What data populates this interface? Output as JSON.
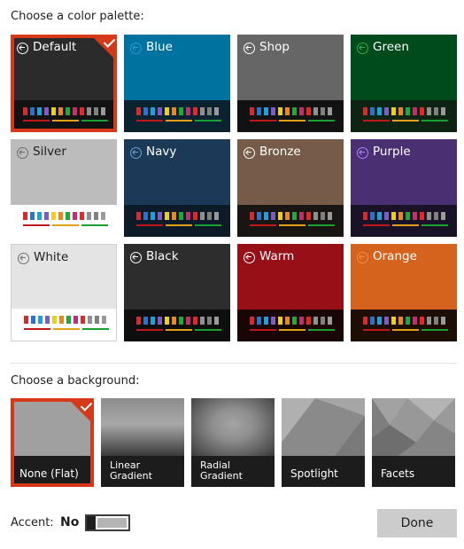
{
  "palette_section": {
    "title": "Choose a color palette:",
    "selected": "Default",
    "palettes": [
      {
        "name": "Default",
        "bg": "#2b2b2b",
        "bar": "#121212",
        "light": false
      },
      {
        "name": "Blue",
        "bg": "#0072a0",
        "bar": "#0b2330",
        "light": false
      },
      {
        "name": "Shop",
        "bg": "#666666",
        "bar": "#121212",
        "light": false
      },
      {
        "name": "Green",
        "bg": "#004b1c",
        "bar": "#0d2412",
        "light": false
      },
      {
        "name": "Silver",
        "bg": "#bcbcbc",
        "bar": "#ffffff",
        "light": true
      },
      {
        "name": "Navy",
        "bg": "#1c3a57",
        "bar": "#0d1a28",
        "light": false
      },
      {
        "name": "Bronze",
        "bg": "#765c48",
        "bar": "#191512",
        "light": false
      },
      {
        "name": "Purple",
        "bg": "#4b2f73",
        "bar": "#1a1226",
        "light": false
      },
      {
        "name": "White",
        "bg": "#e4e4e4",
        "bar": "#ffffff",
        "light": true
      },
      {
        "name": "Black",
        "bg": "#2d2d2d",
        "bar": "#0e0e0e",
        "light": false
      },
      {
        "name": "Warm",
        "bg": "#970f17",
        "bar": "#1a0607",
        "light": false
      },
      {
        "name": "Orange",
        "bg": "#d5621d",
        "bar": "#1e0d04",
        "light": false
      }
    ],
    "swatch_colors": [
      "#d42c2c",
      "#2b72c8",
      "#20a0d8",
      "#7c5cc8",
      "#e8d020",
      "#e88820",
      "#1caa3a",
      "#c0306c",
      "#e02a2a",
      "#909090",
      "#808080",
      "#9a9a9a"
    ],
    "line_colors": [
      "#c01818",
      "#e0a018",
      "#18a030"
    ],
    "accent_icon_colors": {
      "Blue": "#20a0d8",
      "Green": "#2ab04a",
      "Navy": "#6aa0d8",
      "Purple": "#b080ff",
      "Orange": "#f09040"
    }
  },
  "background_section": {
    "title": "Choose a background:",
    "selected": "flat",
    "options": [
      {
        "id": "flat",
        "label": "None (Flat)"
      },
      {
        "id": "linear",
        "label": "Linear\nGradient"
      },
      {
        "id": "radial",
        "label": "Radial\nGradient"
      },
      {
        "id": "spotlight",
        "label": "Spotlight"
      },
      {
        "id": "facets",
        "label": "Facets"
      }
    ]
  },
  "accent": {
    "label": "Accent:",
    "state": "No",
    "enabled": false
  },
  "done_button": {
    "label": "Done"
  },
  "colors": {
    "selection": "#d5391a",
    "done_bg": "#cccccc"
  }
}
